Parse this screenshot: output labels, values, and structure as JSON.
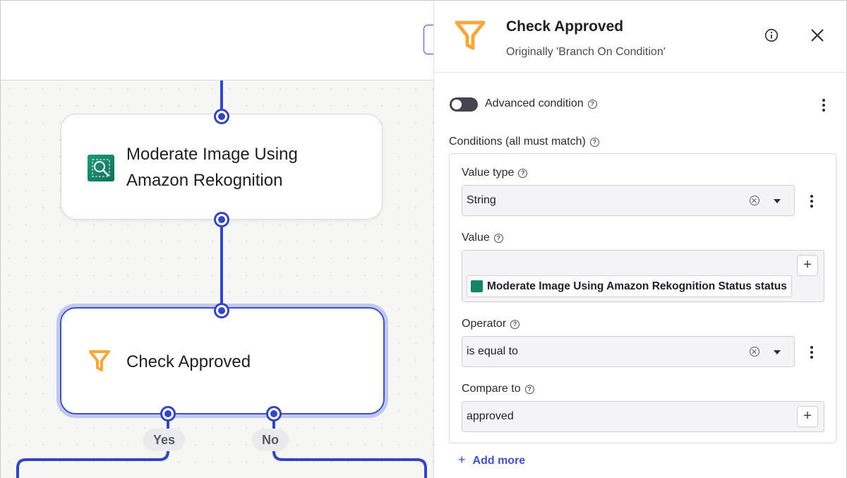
{
  "canvas": {
    "nodes": {
      "rekognition": {
        "title_line1": "Moderate Image Using",
        "title_line2": "Amazon Rekognition",
        "icon": "rekognition-icon"
      },
      "check": {
        "title": "Check Approved",
        "icon": "filter-funnel-icon"
      }
    },
    "branches": {
      "yes": "Yes",
      "no": "No"
    }
  },
  "panel": {
    "title": "Check Approved",
    "subtitle": "Originally 'Branch On Condition'",
    "icons": {
      "header": "filter-funnel-icon",
      "info": "info-icon",
      "close": "close-icon"
    },
    "advanced_label": "Advanced condition",
    "conditions_label": "Conditions (all must match)",
    "value_type": {
      "label": "Value type",
      "value": "String"
    },
    "value": {
      "label": "Value",
      "token": "Moderate Image Using Amazon Rekognition Status status"
    },
    "operator": {
      "label": "Operator",
      "value": "is equal to"
    },
    "compare_to": {
      "label": "Compare to",
      "value": "approved"
    },
    "add_more": "Add more",
    "plus_glyph": "+"
  },
  "colors": {
    "accent": "#3346c0",
    "funnel": "#f6a83b",
    "rekognition": "#148566"
  }
}
